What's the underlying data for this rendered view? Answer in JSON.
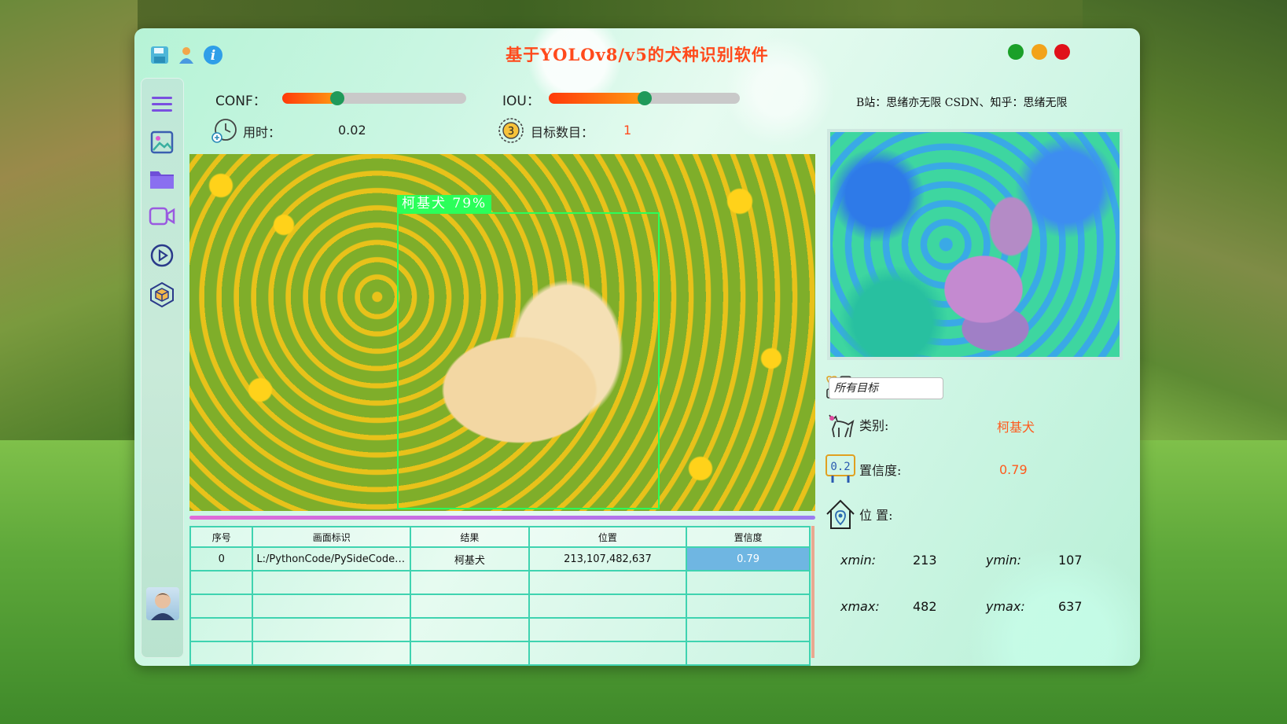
{
  "app": {
    "title": "基于YOLOv8/v5的犬种识别软件"
  },
  "titlebar": {
    "icons": [
      "save-icon",
      "user-icon",
      "info-icon"
    ],
    "window_controls": [
      "maximize",
      "minimize",
      "close"
    ],
    "colors": {
      "green": "#1aa028",
      "yellow": "#f2a31a",
      "red": "#e0111a"
    }
  },
  "sidebar": {
    "items": [
      "menu-icon",
      "image-icon",
      "folder-icon",
      "video-icon",
      "play-icon",
      "model-icon",
      "avatar"
    ]
  },
  "controls": {
    "conf_label": "CONF：",
    "conf_value": 0.3,
    "iou_label": "IOU：",
    "iou_value": 0.5,
    "time_label": "用时：",
    "time_value": "0.02",
    "count_label": "目标数目：",
    "count_value": "1"
  },
  "detection": {
    "label": "柯基犬 79%"
  },
  "table": {
    "headers": [
      "序号",
      "画面标识",
      "结果",
      "位置",
      "置信度"
    ],
    "rows": [
      [
        "0",
        "L:/PythonCode/PySideCode/...",
        "柯基犬",
        "213,107,482,637",
        "0.79"
      ],
      [
        "",
        "",
        "",
        "",
        ""
      ],
      [
        "",
        "",
        "",
        "",
        ""
      ],
      [
        "",
        "",
        "",
        "",
        ""
      ],
      [
        "",
        "",
        "",
        "",
        ""
      ]
    ]
  },
  "right_panel": {
    "credit": "B站：思绪亦无限 CSDN、知乎：思绪无限",
    "filter_value": "所有目标",
    "class_label": "类别:",
    "class_value": "柯基犬",
    "conf_label": "置信度:",
    "conf_value": "0.79",
    "pos_label": "位 置:",
    "xmin_label": "xmin:",
    "xmin": "213",
    "ymin_label": "ymin:",
    "ymin": "107",
    "xmax_label": "xmax:",
    "xmax": "482",
    "ymax_label": "ymax:",
    "ymax": "637"
  }
}
